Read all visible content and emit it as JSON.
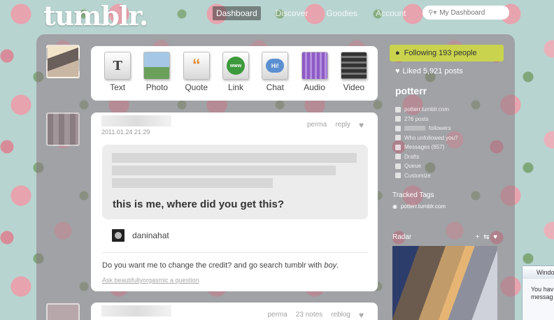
{
  "header": {
    "logo": "tumblr.",
    "nav": [
      {
        "label": "Dashboard",
        "active": true
      },
      {
        "label": "Discover",
        "active": false
      },
      {
        "label": "Goodies",
        "active": false
      },
      {
        "label": "Account",
        "active": false
      }
    ],
    "search_placeholder": "My Dashboard"
  },
  "postbar": {
    "items": [
      {
        "label": "Text",
        "icon": "text-post-icon"
      },
      {
        "label": "Photo",
        "icon": "photo-post-icon"
      },
      {
        "label": "Quote",
        "icon": "quote-post-icon"
      },
      {
        "label": "Link",
        "icon": "link-post-icon"
      },
      {
        "label": "Chat",
        "icon": "chat-post-icon"
      },
      {
        "label": "Audio",
        "icon": "audio-post-icon"
      },
      {
        "label": "Video",
        "icon": "video-post-icon"
      }
    ]
  },
  "post1": {
    "date": "2011.01.24 21:29",
    "links": {
      "perma": "perma",
      "reply": "reply"
    },
    "quote": "this is me, where did you get this?",
    "source_name": "daninahat",
    "body_prefix": "Do you want me to change the credit? and go search tumblr with ",
    "body_italic": "boy",
    "body_suffix": ".",
    "ask_link": "Ask beautifullyorgasmic a question"
  },
  "post2": {
    "links": {
      "perma": "perma",
      "notes": "23 notes",
      "reblog": "reblog"
    }
  },
  "sidebar": {
    "following": "Following 193 people",
    "liked": "Liked 5,921 posts",
    "blog_name": "potterr",
    "menu": [
      {
        "label": "potterr.tumblr.com",
        "icon": "home-icon"
      },
      {
        "label": "276 posts",
        "icon": "posts-icon"
      },
      {
        "label": "followers",
        "icon": "followers-icon"
      },
      {
        "label": "Who unfollowed you?",
        "icon": "heart-icon"
      },
      {
        "label": "Messages (657)",
        "icon": "mail-icon"
      },
      {
        "label": "Drafts",
        "icon": "drafts-icon"
      },
      {
        "label": "Queue",
        "icon": "queue-icon"
      },
      {
        "label": "Customize",
        "icon": "wrench-icon"
      }
    ],
    "tracked_title": "Tracked Tags",
    "tracked": [
      "potterr.tumblr.com"
    ],
    "radar_title": "Radar"
  },
  "popup": {
    "title": "Windo",
    "body_line1": "You hav",
    "body_line2": "messag"
  }
}
